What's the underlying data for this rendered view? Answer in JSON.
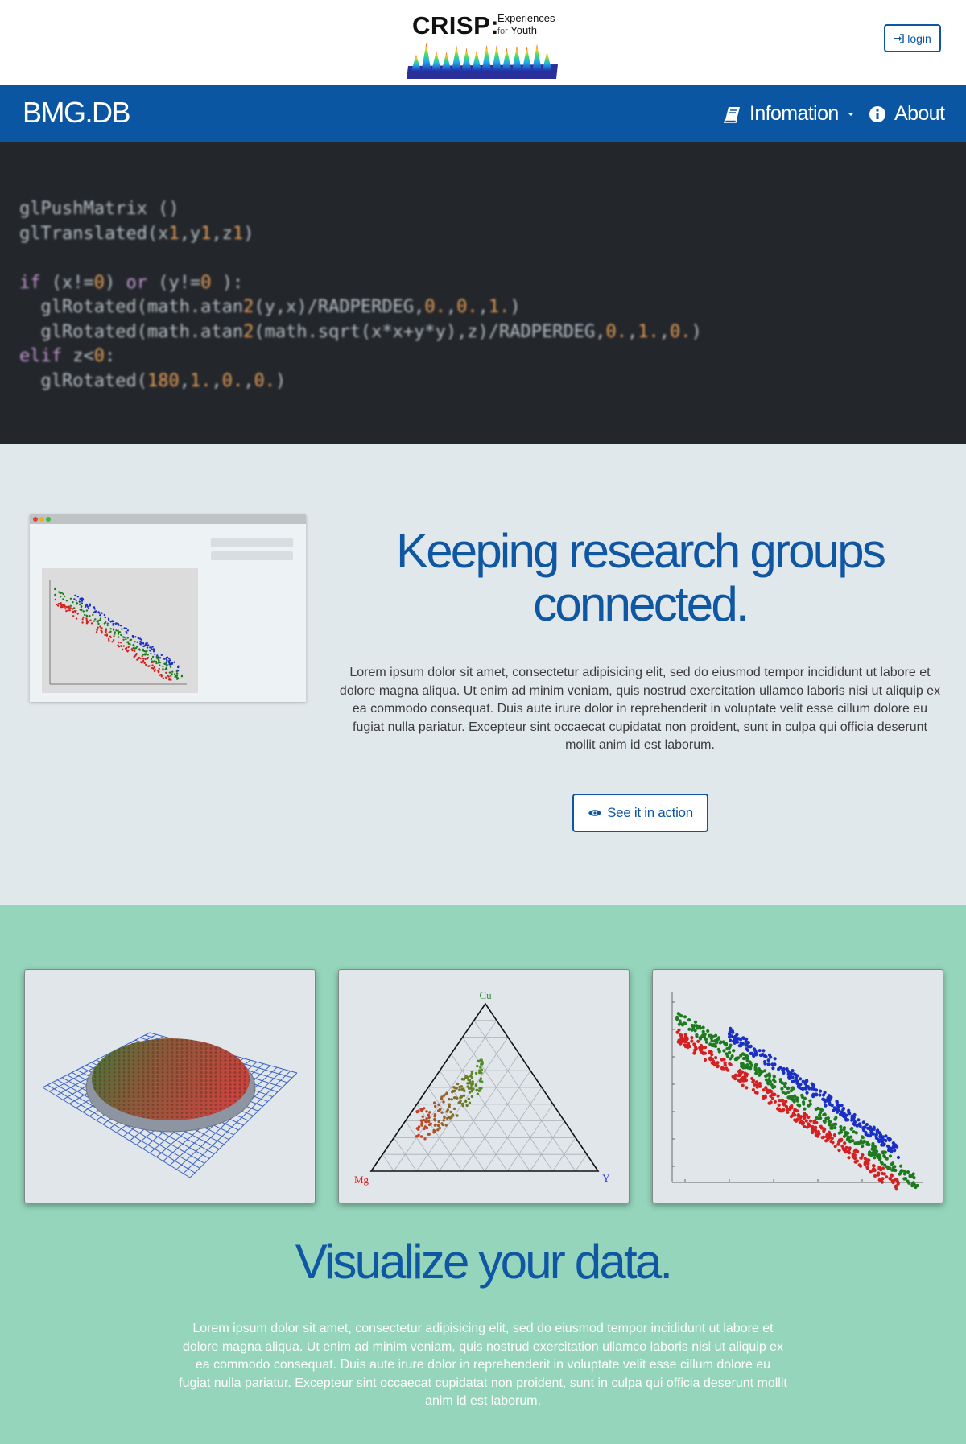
{
  "header": {
    "logo": {
      "wordmark": "CRISP:",
      "tagline_line1": "Experiences",
      "tagline_line2_prefix": "for",
      "tagline_line2": "Youth"
    },
    "login_label": "login"
  },
  "navbar": {
    "brand": "BMG.DB",
    "items": [
      {
        "label": "Infomation",
        "icon": "book-icon",
        "dropdown": true
      },
      {
        "label": "About",
        "icon": "info-circle-icon",
        "dropdown": false
      }
    ]
  },
  "code_banner": {
    "lines": [
      "glPushMatrix ()",
      "glTranslated(x1,y1,z1)",
      "",
      "if (x!=0) or (y!=0 ):",
      "  glRotated(math.atan2(y,x)/RADPERDEG,0.,0.,1.)",
      "  glRotated(math.atan2(math.sqrt(x*x+y*y),z)/RADPERDEG,0.,1.,0.)",
      "elif z<0:",
      "  glRotated(180,1.,0.,0.)"
    ]
  },
  "research": {
    "headline": "Keeping research groups connected.",
    "body": "Lorem ipsum dolor sit amet, consectetur adipisicing elit, sed do eiusmod tempor incididunt ut labore et dolore magna aliqua. Ut enim ad minim veniam, quis nostrud exercitation ullamco laboris nisi ut aliquip ex ea commodo consequat. Duis aute irure dolor in reprehenderit in voluptate velit esse cillum dolore eu fugiat nulla pariatur. Excepteur sint occaecat cupidatat non proident, sunt in culpa qui officia deserunt mollit anim id est laborum.",
    "button_label": "See it in action"
  },
  "visualize": {
    "ternary_labels": {
      "top": "Cu",
      "left": "Mg",
      "right": "Y"
    },
    "headline": "Visualize your data.",
    "body": "Lorem ipsum dolor sit amet, consectetur adipisicing elit, sed do eiusmod tempor incididunt ut labore et dolore magna aliqua. Ut enim ad minim veniam, quis nostrud exercitation ullamco laboris nisi ut aliquip ex ea commodo consequat. Duis aute irure dolor in reprehenderit in voluptate velit esse cillum dolore eu fugiat nulla pariatur. Excepteur sint occaecat cupidatat non proident, sunt in culpa qui officia deserunt mollit anim id est laborum."
  },
  "colors": {
    "brand_blue": "#0b56a3",
    "code_bg": "#23262a",
    "section_grey": "#e1e8ec",
    "section_green": "#95d5bb",
    "series_blue": "#1a2fc4",
    "series_green": "#1f7a1f",
    "series_red": "#d42020"
  }
}
